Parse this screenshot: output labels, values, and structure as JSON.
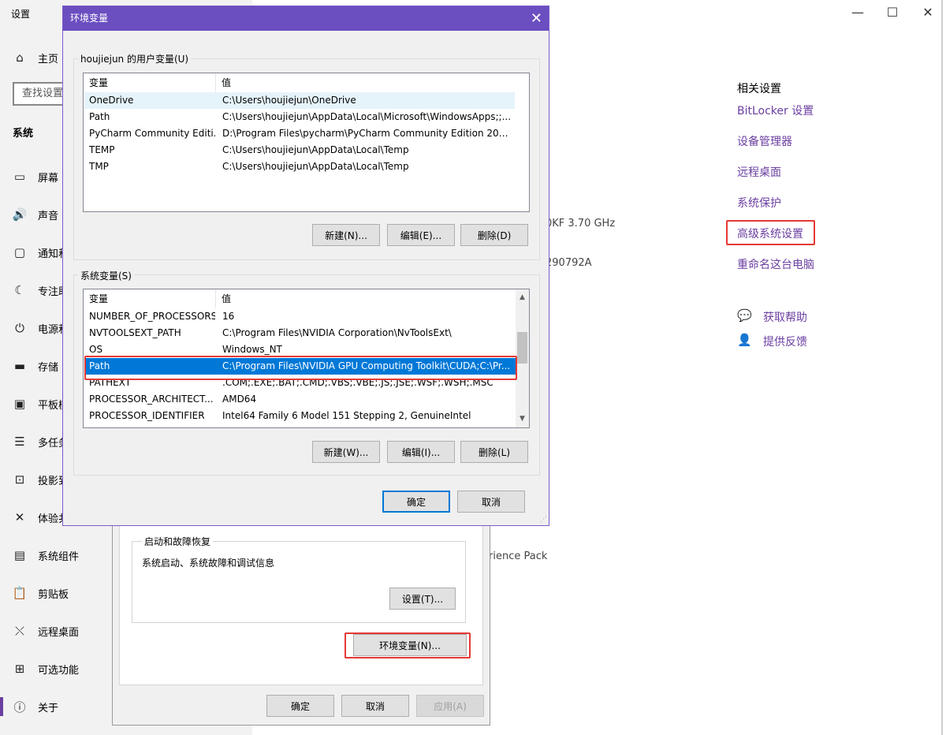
{
  "settings": {
    "window_title": "设置",
    "home_label": "主页",
    "search_placeholder": "查找设置",
    "section_label": "系统",
    "nav": [
      {
        "icon": "display-icon",
        "label": "屏幕"
      },
      {
        "icon": "sound-icon",
        "label": "声音"
      },
      {
        "icon": "notification-icon",
        "label": "通知和"
      },
      {
        "icon": "focus-assist-icon",
        "label": "专注助"
      },
      {
        "icon": "power-icon",
        "label": "电源和"
      },
      {
        "icon": "storage-icon",
        "label": "存储"
      },
      {
        "icon": "tablet-icon",
        "label": "平板模"
      },
      {
        "icon": "multitasking-icon",
        "label": "多任务"
      },
      {
        "icon": "projecting-icon",
        "label": "投影到"
      },
      {
        "icon": "shared-experiences-icon",
        "label": "体验共"
      },
      {
        "icon": "system-components-icon",
        "label": "系统组件"
      },
      {
        "icon": "clipboard-icon",
        "label": "剪贴板"
      },
      {
        "icon": "remote-desktop-icon",
        "label": "远程桌面"
      },
      {
        "icon": "optional-features-icon",
        "label": "可选功能"
      },
      {
        "icon": "about-icon",
        "label": "关于"
      }
    ],
    "related_title": "相关设置",
    "related_links": [
      "BitLocker 设置",
      "设备管理器",
      "远程桌面",
      "系统保护",
      "高级系统设置",
      "重命名这台电脑"
    ],
    "help_links": [
      {
        "icon": "get-help-icon",
        "label": "获取帮助"
      },
      {
        "icon": "feedback-icon",
        "label": "提供反馈"
      }
    ],
    "bg_fragments": {
      "cpu": "0KF   3.70 GHz",
      "product_id": "290792A",
      "experience": "rience Pack"
    }
  },
  "sysprop": {
    "startup_group_label": "启动和故障恢复",
    "startup_desc": "系统启动、系统故障和调试信息",
    "settings_button": "设置(T)...",
    "env_button": "环境变量(N)...",
    "ok": "确定",
    "cancel": "取消",
    "apply": "应用(A)"
  },
  "env_dialog": {
    "title": "环境变量",
    "user_group_label": "houjiejun 的用户变量(U)",
    "sys_group_label": "系统变量(S)",
    "col_variable": "变量",
    "col_value": "值",
    "user_vars": [
      {
        "name": "OneDrive",
        "value": "C:\\Users\\houjiejun\\OneDrive"
      },
      {
        "name": "Path",
        "value": "C:\\Users\\houjiejun\\AppData\\Local\\Microsoft\\WindowsApps;;..."
      },
      {
        "name": "PyCharm Community Editi...",
        "value": "D:\\Program Files\\pycharm\\PyCharm Community Edition 2025...."
      },
      {
        "name": "TEMP",
        "value": "C:\\Users\\houjiejun\\AppData\\Local\\Temp"
      },
      {
        "name": "TMP",
        "value": "C:\\Users\\houjiejun\\AppData\\Local\\Temp"
      }
    ],
    "sys_vars": [
      {
        "name": "NUMBER_OF_PROCESSORS",
        "value": "16"
      },
      {
        "name": "NVTOOLSEXT_PATH",
        "value": "C:\\Program Files\\NVIDIA Corporation\\NvToolsExt\\"
      },
      {
        "name": "OS",
        "value": "Windows_NT"
      },
      {
        "name": "Path",
        "value": "C:\\Program Files\\NVIDIA GPU Computing Toolkit\\CUDA;C:\\Pr..."
      },
      {
        "name": "PATHEXT",
        "value": ".COM;.EXE;.BAT;.CMD;.VBS;.VBE;.JS;.JSE;.WSF;.WSH;.MSC"
      },
      {
        "name": "PROCESSOR_ARCHITECT...",
        "value": "AMD64"
      },
      {
        "name": "PROCESSOR_IDENTIFIER",
        "value": "Intel64 Family 6 Model 151 Stepping 2, GenuineIntel"
      }
    ],
    "user_buttons": {
      "new": "新建(N)...",
      "edit": "编辑(E)...",
      "delete": "删除(D)"
    },
    "sys_buttons": {
      "new": "新建(W)...",
      "edit": "编辑(I)...",
      "delete": "删除(L)"
    },
    "ok": "确定",
    "cancel": "取消"
  },
  "colors": {
    "accent": "#6b3fa0",
    "titlebar": "#6b4ec0",
    "selection": "#0078d7",
    "highlight_box": "#e53935"
  }
}
